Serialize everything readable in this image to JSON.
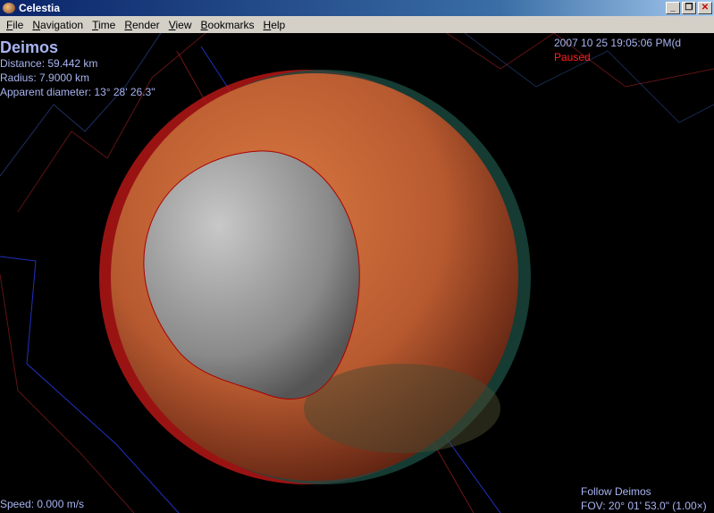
{
  "window": {
    "title": "Celestia",
    "minimize": "_",
    "restore": "❐",
    "close": "✕"
  },
  "menu": [
    "File",
    "Navigation",
    "Time",
    "Render",
    "View",
    "Bookmarks",
    "Help"
  ],
  "info": {
    "name": "Deimos",
    "distance": "Distance: 59.442 km",
    "radius": "Radius: 7.9000 km",
    "apparent_diameter": "Apparent diameter: 13° 28' 26.3\""
  },
  "time": {
    "datetime": "2007 10 25 19:05:06 PM(d",
    "status": "Paused"
  },
  "speed": "Speed: 0.000 m/s",
  "follow": "Follow Deimos",
  "fov": "FOV: 20° 01' 53.0\" (1.00×)"
}
